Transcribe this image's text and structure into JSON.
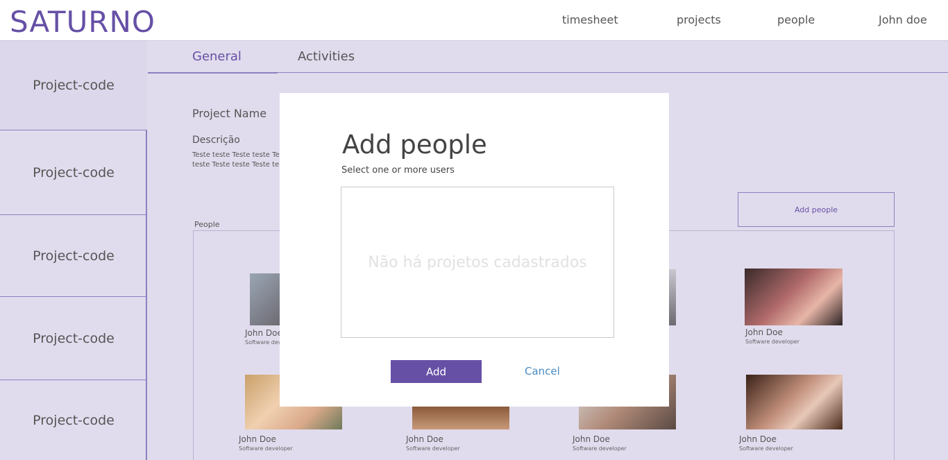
{
  "header": {
    "logo": "SATURNO",
    "nav": [
      "timesheet",
      "projects",
      "people",
      "John doe"
    ]
  },
  "sidebar": {
    "items": [
      {
        "label": "Project-code"
      },
      {
        "label": "Project-code"
      },
      {
        "label": "Project-code"
      },
      {
        "label": "Project-code"
      },
      {
        "label": "Project-code"
      }
    ]
  },
  "tabs": {
    "general": "General",
    "activities": "Activities"
  },
  "project": {
    "name_label": "Project Name",
    "desc_label": "Descrição",
    "desc_line1": "Teste teste Teste teste Te",
    "desc_line2": "teste Teste teste Teste te",
    "people_label": "People",
    "add_people_button": "Add people"
  },
  "people": [
    {
      "name": "John Doe",
      "role": "Software developer"
    },
    {
      "name": "John Doe",
      "role": "Software developer"
    },
    {
      "name": "John Doe",
      "role": "Software developer"
    },
    {
      "name": "John Doe",
      "role": "Software developer"
    },
    {
      "name": "John Doe",
      "role": "Software developer"
    },
    {
      "name": "John Doe",
      "role": "Software developer"
    }
  ],
  "modal": {
    "title": "Add people",
    "subtitle": "Select one or more users",
    "empty_text": "Não há projetos cadastrados",
    "add_button": "Add",
    "cancel_button": "Cancel"
  },
  "colors": {
    "brand": "#6650a6",
    "background": "#e1dced",
    "link": "#4a8cc4"
  }
}
